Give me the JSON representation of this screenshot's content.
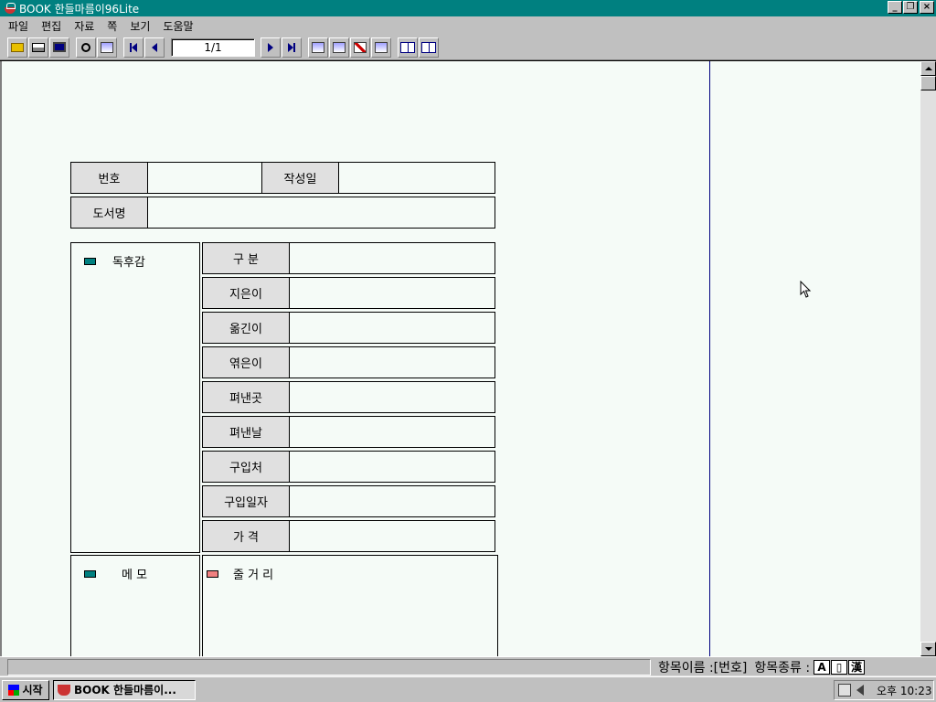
{
  "window": {
    "title": "BOOK   한들마름이96Lite"
  },
  "menu": [
    "파일",
    "편집",
    "자료",
    "쪽",
    "보기",
    "도움말"
  ],
  "toolbar": {
    "page_indicator": "1/1"
  },
  "form": {
    "number_label": "번호",
    "created_label": "작성일",
    "title_label": "도서명",
    "review_label": "독후감",
    "memo_label": "메 모",
    "summary_label": "줄 거 리",
    "fields": [
      "구  분",
      "지은이",
      "옮긴이",
      "엮은이",
      "펴낸곳",
      "펴낸날",
      "구입처",
      "구입일자",
      "가  격"
    ]
  },
  "colors": {
    "accent_teal": "#008080",
    "summary_swatch": "#f08080"
  },
  "status": {
    "field_name": "항목이름 :[번호]",
    "field_type": "항목종류 :",
    "type_icons": [
      "A",
      "▯",
      "漢"
    ]
  },
  "taskbar": {
    "start_label": "시작",
    "task_label": "BOOK   한들마름이...",
    "clock": "오후 10:23"
  }
}
